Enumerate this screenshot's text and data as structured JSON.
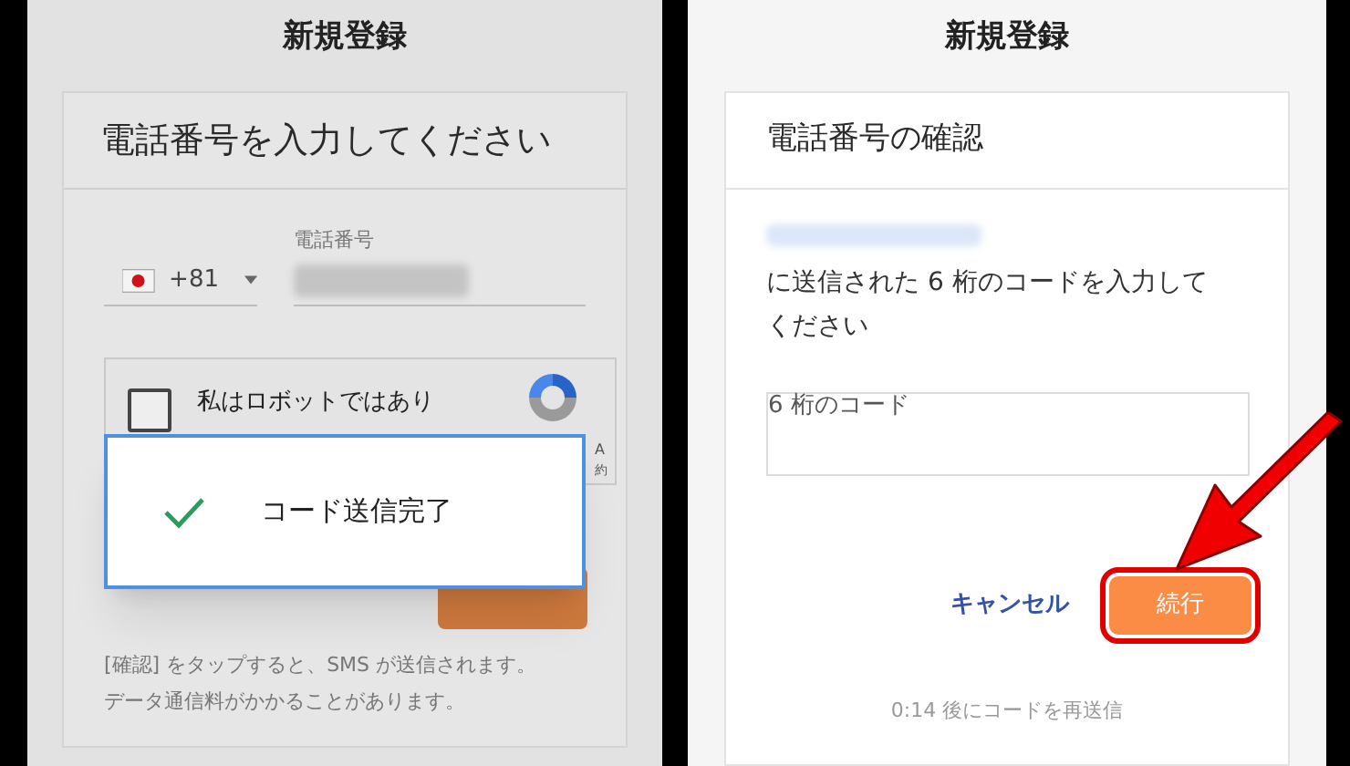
{
  "phone_entry_screen": {
    "title": "新規登録",
    "heading": "電話番号を入力してください",
    "country_code": "+81",
    "phone_label": "電話番号",
    "captcha": {
      "label": "私はロボットではあり",
      "checked": false,
      "brand_fragment": "A",
      "terms_fragment": "約"
    },
    "toast": {
      "message": "コード送信完了"
    },
    "notice_lines": [
      "[確認] をタップすると、SMS が送信されます。",
      "データ通信料がかかることがあります。"
    ]
  },
  "verification_screen": {
    "title": "新規登録",
    "heading": "電話番号の確認",
    "instruction": "に送信された 6 桁のコードを入力してください",
    "code_field": {
      "label": "6 桁のコード"
    },
    "buttons": [
      {
        "label": "キャンセル",
        "kind": "text",
        "highlighted": false
      },
      {
        "label": "続行",
        "kind": "primary",
        "highlighted": true
      }
    ],
    "resend": "0:14 後にコードを再送信"
  }
}
